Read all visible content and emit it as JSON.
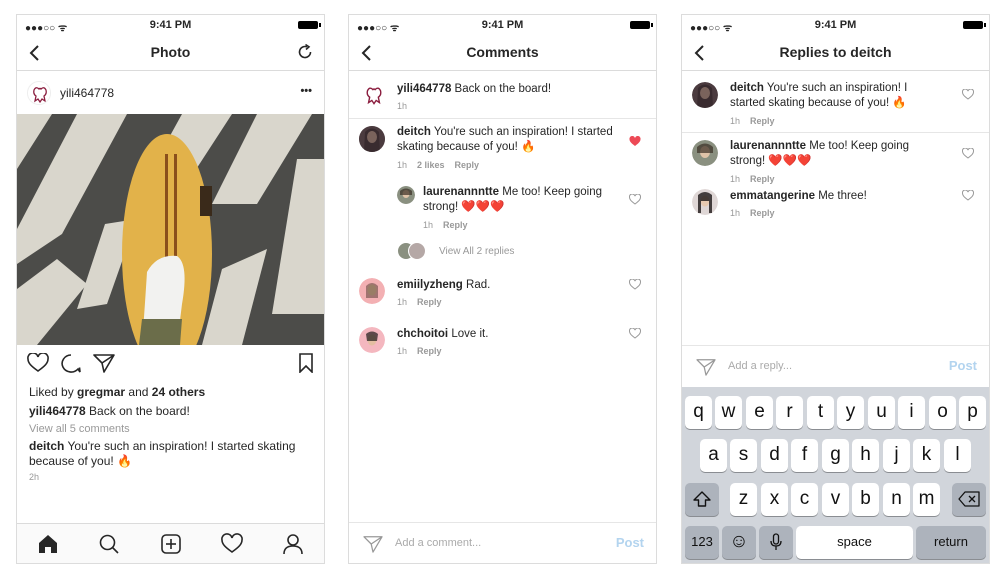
{
  "status": {
    "time": "9:41 PM",
    "signal": "●●●○○ ᯤ"
  },
  "screen1": {
    "title": "Photo",
    "post_user": "yili464778",
    "more": "•••",
    "liked_prefix": "Liked by ",
    "liked_user": "gregmar",
    "liked_and": " and ",
    "liked_others": "24 others",
    "caption_user": "yili464778",
    "caption_text": " Back on the board!",
    "view_all": "View all 5 comments",
    "comment_user": "deitch",
    "comment_text": " You're such an inspiration! I started skating because of you! 🔥",
    "time": "2h"
  },
  "screen2": {
    "title": "Comments",
    "items": [
      {
        "user": "yili464778",
        "text": " Back on the board!",
        "time": "1h"
      },
      {
        "user": "deitch",
        "text": " You're such an inspiration! I started skating because of you! 🔥",
        "time": "1h",
        "likes": "2 likes",
        "reply": "Reply"
      },
      {
        "user": "laurenannntte",
        "text": " Me too! Keep going strong! ❤️❤️❤️",
        "time": "1h",
        "reply": "Reply"
      },
      {
        "user": "emiilyzheng",
        "text": " Rad.",
        "time": "1h",
        "reply": "Reply"
      },
      {
        "user": "chchoitoi",
        "text": " Love it.",
        "time": "1h",
        "reply": "Reply"
      }
    ],
    "view_replies": "View All 2 replies",
    "placeholder": "Add a comment...",
    "post": "Post"
  },
  "screen3": {
    "title": "Replies to deitch",
    "items": [
      {
        "user": "deitch",
        "text": " You're such an inspiration! I started skating because of you! 🔥",
        "time": "1h",
        "reply": "Reply"
      },
      {
        "user": "laurenannntte",
        "text": " Me too! Keep going strong! ❤️❤️❤️",
        "time": "1h",
        "reply": "Reply"
      },
      {
        "user": "emmatangerine",
        "text": " Me three!",
        "time": "1h",
        "reply": "Reply"
      }
    ],
    "placeholder": "Add a reply...",
    "post": "Post"
  },
  "keyboard": {
    "row1": [
      "q",
      "w",
      "e",
      "r",
      "t",
      "y",
      "u",
      "i",
      "o",
      "p"
    ],
    "row2": [
      "a",
      "s",
      "d",
      "f",
      "g",
      "h",
      "j",
      "k",
      "l"
    ],
    "row3": [
      "z",
      "x",
      "c",
      "v",
      "b",
      "n",
      "m"
    ],
    "num": "123",
    "space": "space",
    "return": "return",
    "emoji": "☺",
    "mic": "🎤"
  },
  "colors": {
    "like_red": "#ed4956",
    "post_blue": "#b3d4ef",
    "keyboard_bg": "#d1d5db"
  }
}
